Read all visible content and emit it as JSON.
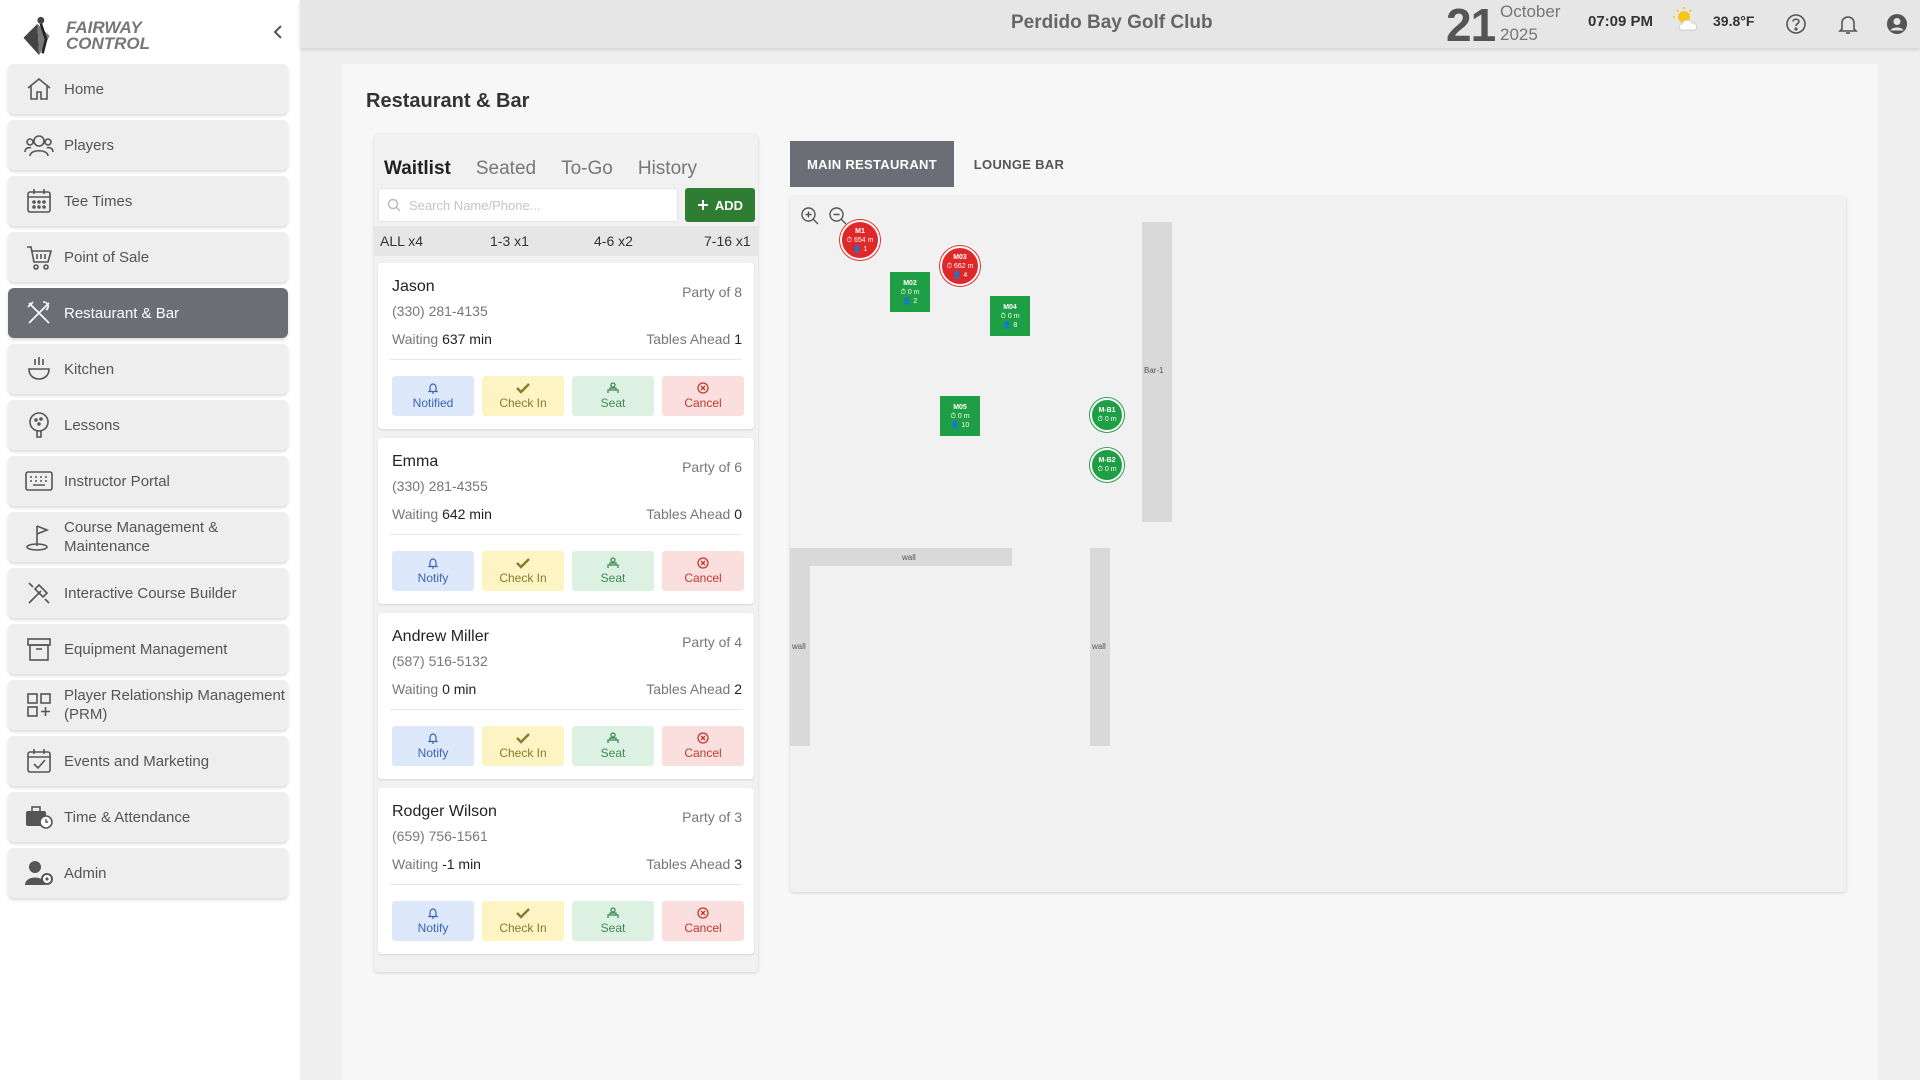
{
  "app": {
    "logo_text_line1": "FAIRWAY",
    "logo_text_line2": "CONTROL",
    "club_name": "Perdido Bay Golf Club",
    "date_day": "21",
    "date_month": "October",
    "date_year": "2025",
    "time": "07:09  PM",
    "temperature": "39.8°F"
  },
  "sidebar": {
    "items": [
      {
        "label": "Home",
        "icon": "home-icon"
      },
      {
        "label": "Players",
        "icon": "players-icon"
      },
      {
        "label": "Tee Times",
        "icon": "calendar-icon"
      },
      {
        "label": "Point of Sale",
        "icon": "cart-icon"
      },
      {
        "label": "Restaurant & Bar",
        "icon": "utensils-icon",
        "active": true
      },
      {
        "label": "Kitchen",
        "icon": "kitchen-icon"
      },
      {
        "label": "Lessons",
        "icon": "lessons-icon"
      },
      {
        "label": "Instructor Portal",
        "icon": "keyboard-icon"
      },
      {
        "label": "Course Management & Maintenance",
        "icon": "flag-icon"
      },
      {
        "label": "Interactive Course Builder",
        "icon": "builder-icon"
      },
      {
        "label": "Equipment Management",
        "icon": "archive-icon"
      },
      {
        "label": "Player Relationship Management (PRM)",
        "icon": "grid-icon"
      },
      {
        "label": "Events and Marketing",
        "icon": "calendar-check-icon"
      },
      {
        "label": "Time & Attendance",
        "icon": "briefcase-clock-icon"
      },
      {
        "label": "Admin",
        "icon": "user-gear-icon"
      }
    ]
  },
  "page": {
    "title": "Restaurant & Bar"
  },
  "waitlist": {
    "tabs": [
      "Waitlist",
      "Seated",
      "To-Go",
      "History"
    ],
    "active_tab": "Waitlist",
    "search_placeholder": "Search Name/Phone...",
    "add_label": "ADD",
    "filters": [
      "ALL x4",
      "1-3 x1",
      "4-6 x2",
      "7-16 x1"
    ],
    "entries": [
      {
        "name": "Jason",
        "party": "Party of 8",
        "phone": "(330) 281-4135",
        "wait_label": "Waiting",
        "wait": "637 min",
        "ahead_label": "Tables Ahead",
        "ahead": "1",
        "notify_label": "Notified"
      },
      {
        "name": "Emma",
        "party": "Party of 6",
        "phone": "(330) 281-4355",
        "wait_label": "Waiting",
        "wait": "642 min",
        "ahead_label": "Tables Ahead",
        "ahead": "0",
        "notify_label": "Notify"
      },
      {
        "name": "Andrew Miller",
        "party": "Party of 4",
        "phone": "(587) 516-5132",
        "wait_label": "Waiting",
        "wait": "0 min",
        "ahead_label": "Tables Ahead",
        "ahead": "2",
        "notify_label": "Notify"
      },
      {
        "name": "Rodger Wilson",
        "party": "Party of 3",
        "phone": "(659) 756-1561",
        "wait_label": "Waiting",
        "wait": "-1 min",
        "ahead_label": "Tables Ahead",
        "ahead": "3",
        "notify_label": "Notify"
      }
    ],
    "actions": {
      "check_in": "Check In",
      "seat": "Seat",
      "cancel": "Cancel"
    }
  },
  "floor": {
    "rooms": [
      "MAIN RESTAURANT",
      "LOUNGE BAR"
    ],
    "active_room": "MAIN RESTAURANT",
    "walls": {
      "bar": "Bar-1",
      "wall": "wall"
    },
    "tables": [
      {
        "id": "M1",
        "time": "654 m",
        "guests": "1",
        "status": "red",
        "shape": "round"
      },
      {
        "id": "M02",
        "time": "0 m",
        "guests": "2",
        "status": "green",
        "shape": "square"
      },
      {
        "id": "M03",
        "time": "662 m",
        "guests": "4",
        "status": "red",
        "shape": "round"
      },
      {
        "id": "M04",
        "time": "0 m",
        "guests": "8",
        "status": "green",
        "shape": "square"
      },
      {
        "id": "M05",
        "time": "0 m",
        "guests": "10",
        "status": "green",
        "shape": "square"
      },
      {
        "id": "M-B1",
        "time": "0 m",
        "guests": "",
        "status": "green",
        "shape": "round"
      },
      {
        "id": "M-B2",
        "time": "0 m",
        "guests": "",
        "status": "green",
        "shape": "round"
      }
    ]
  },
  "colors": {
    "active_nav": "#6b6e74",
    "add_button": "#2e7d32",
    "table_occupied": "#e02828",
    "table_available": "#1e9e45"
  }
}
